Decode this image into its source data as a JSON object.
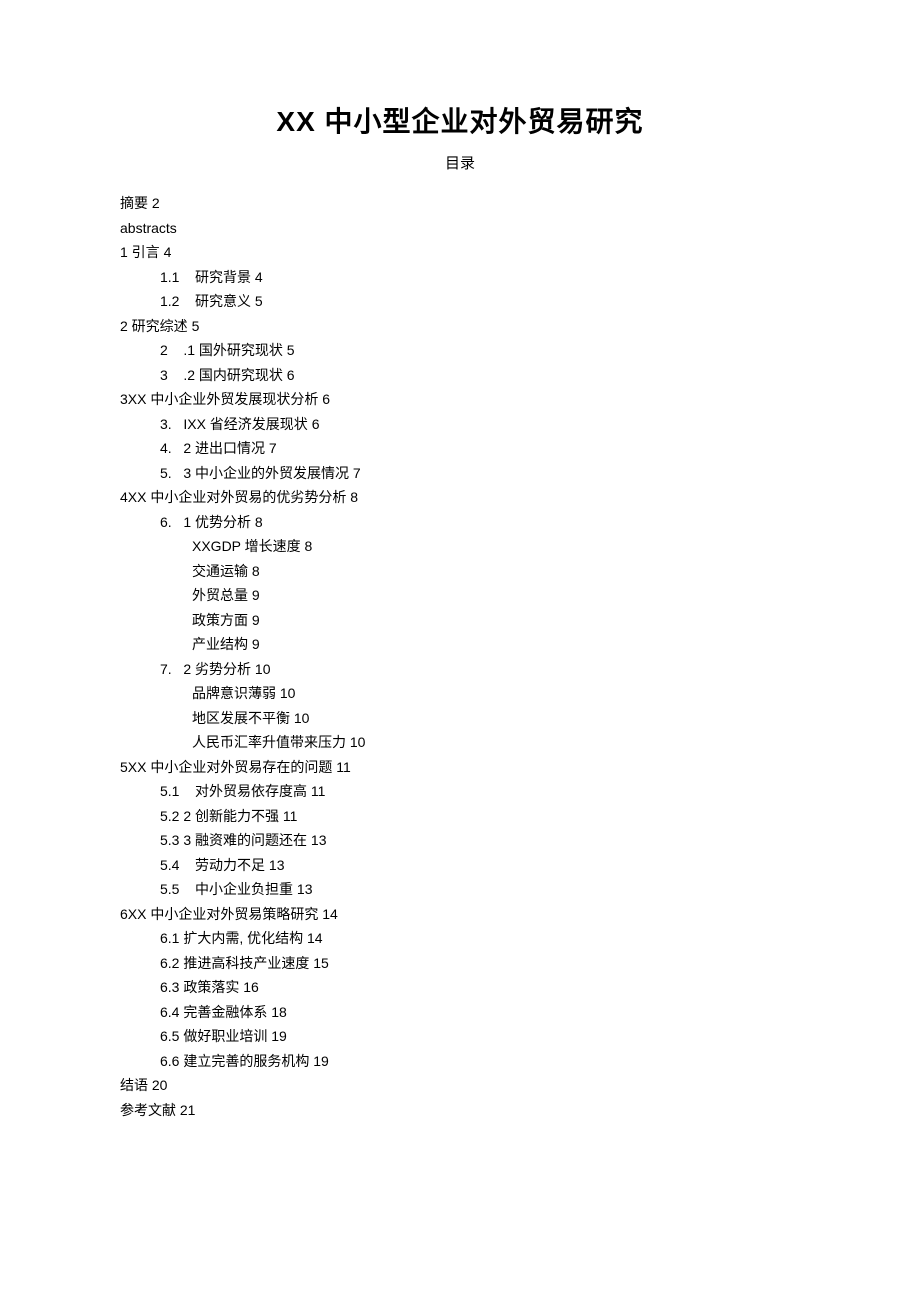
{
  "title": "XX 中小型企业对外贸易研究",
  "subtitle": "目录",
  "toc": [
    {
      "lvl": 0,
      "text": "摘要 2"
    },
    {
      "lvl": 0,
      "text": "abstracts"
    },
    {
      "lvl": 0,
      "text": "1 引言 4"
    },
    {
      "lvl": 1,
      "text": "1.1    研究背景 4"
    },
    {
      "lvl": 1,
      "text": "1.2    研究意义 5"
    },
    {
      "lvl": 0,
      "text": "2 研究综述 5"
    },
    {
      "lvl": 1,
      "text": "2    .1 国外研究现状 5"
    },
    {
      "lvl": 1,
      "text": "3    .2 国内研究现状 6"
    },
    {
      "lvl": 0,
      "text": "3XX 中小企业外贸发展现状分析 6"
    },
    {
      "lvl": 1,
      "text": "3.   IXX 省经济发展现状 6"
    },
    {
      "lvl": 1,
      "text": "4.   2 进出口情况 7"
    },
    {
      "lvl": 1,
      "text": "5.   3 中小企业的外贸发展情况 7"
    },
    {
      "lvl": 0,
      "text": "4XX 中小企业对外贸易的优劣势分析 8"
    },
    {
      "lvl": 1,
      "text": "6.   1 优势分析 8"
    },
    {
      "lvl": 2,
      "text": "XXGDP 增长速度 8"
    },
    {
      "lvl": 2,
      "text": "交通运输 8"
    },
    {
      "lvl": 2,
      "text": "外贸总量 9"
    },
    {
      "lvl": 2,
      "text": "政策方面 9"
    },
    {
      "lvl": 2,
      "text": "产业结构 9"
    },
    {
      "lvl": 1,
      "text": "7.   2 劣势分析 10"
    },
    {
      "lvl": 2,
      "text": "品牌意识薄弱 10"
    },
    {
      "lvl": 2,
      "text": "地区发展不平衡 10"
    },
    {
      "lvl": 2,
      "text": "人民币汇率升值带来压力 10"
    },
    {
      "lvl": 0,
      "text": "5XX 中小企业对外贸易存在的问题 11"
    },
    {
      "lvl": 1,
      "text": "5.1    对外贸易依存度高 11"
    },
    {
      "lvl": 1,
      "text": "5.2 2 创新能力不强 11"
    },
    {
      "lvl": 1,
      "text": "5.3 3 融资难的问题还在 13"
    },
    {
      "lvl": 1,
      "text": "5.4    劳动力不足 13"
    },
    {
      "lvl": 1,
      "text": "5.5    中小企业负担重 13"
    },
    {
      "lvl": 0,
      "text": "6XX 中小企业对外贸易策略研究 14"
    },
    {
      "lvl": 1,
      "text": "6.1 扩大内需, 优化结构 14"
    },
    {
      "lvl": 1,
      "text": "6.2 推进高科技产业速度 15"
    },
    {
      "lvl": 1,
      "text": "6.3 政策落实 16"
    },
    {
      "lvl": 1,
      "text": "6.4 完善金融体系 18"
    },
    {
      "lvl": 1,
      "text": "6.5 做好职业培训 19"
    },
    {
      "lvl": 1,
      "text": "6.6 建立完善的服务机构 19"
    },
    {
      "lvl": 0,
      "text": "结语 20"
    },
    {
      "lvl": 0,
      "text": "参考文献 21"
    }
  ]
}
